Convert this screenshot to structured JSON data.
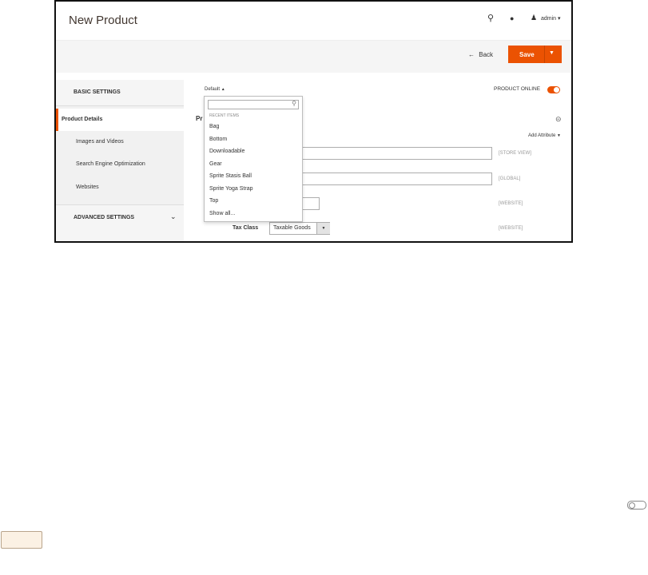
{
  "header": {
    "title": "New Product",
    "user": "admin ▾"
  },
  "actions": {
    "back_label": "Back",
    "save_label": "Save"
  },
  "sidebar": {
    "basic_heading": "BASIC SETTINGS",
    "items": [
      {
        "label": "Product Details",
        "active": true
      },
      {
        "label": "Images and Videos"
      },
      {
        "label": "Search Engine Optimization"
      },
      {
        "label": "Websites"
      }
    ],
    "advanced_heading": "ADVANCED SETTINGS"
  },
  "content": {
    "attribute_set": "Default",
    "product_online_label": "PRODUCT ONLINE",
    "section_title_partial": "Pr",
    "add_attribute": "Add Attribute",
    "scopes": [
      "[STORE VIEW]",
      "[GLOBAL]",
      "[WEBSITE]",
      "[WEBSITE]"
    ],
    "tax_class_label": "Tax Class",
    "tax_class_value": "Taxable Goods"
  },
  "dropdown": {
    "heading": "RECENT ITEMS",
    "items": [
      "Bag",
      "Bottom",
      "Downloadable",
      "Gear",
      "Sprite Stasis Ball",
      "Sprite Yoga Strap",
      "Top",
      "Show all..."
    ]
  },
  "colors": {
    "accent": "#eb5202",
    "toggle_on": "#eb5202"
  }
}
